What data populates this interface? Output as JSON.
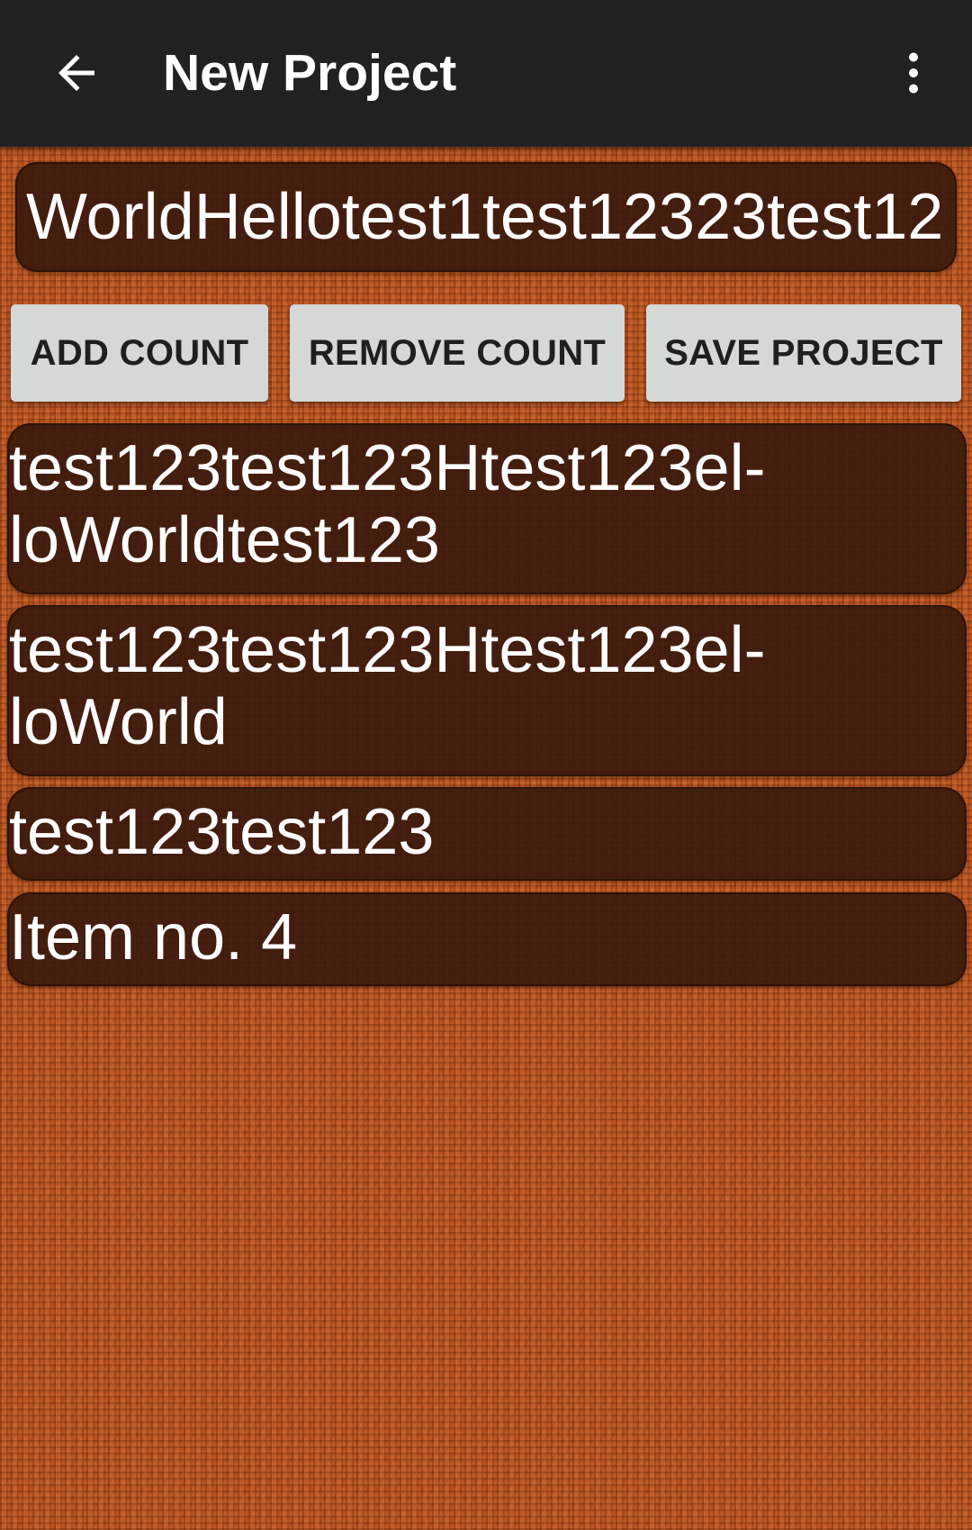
{
  "app_bar": {
    "title": "New Project",
    "back_icon": "arrow-back-icon",
    "overflow_icon": "more-vert-icon",
    "background_color": "#212121"
  },
  "project_name": {
    "value": "WorldHellotest1test12323test12"
  },
  "buttons": {
    "add_count": "ADD COUNT",
    "remove_count": "REMOVE COUNT",
    "save_project": "SAVE PROJECT",
    "color": "#d6d7d7"
  },
  "items": [
    {
      "lines": [
        "test123test123Htest123el-",
        "loWorldtest123"
      ]
    },
    {
      "lines": [
        "test123test123Htest123el-",
        "loWorld"
      ]
    },
    {
      "lines": [
        "test123test123"
      ]
    },
    {
      "lines": [
        "Item no. 4"
      ]
    }
  ],
  "background": {
    "texture": "orange-knit-fabric",
    "base_color": "#b8521f",
    "card_color": "#37180c"
  }
}
